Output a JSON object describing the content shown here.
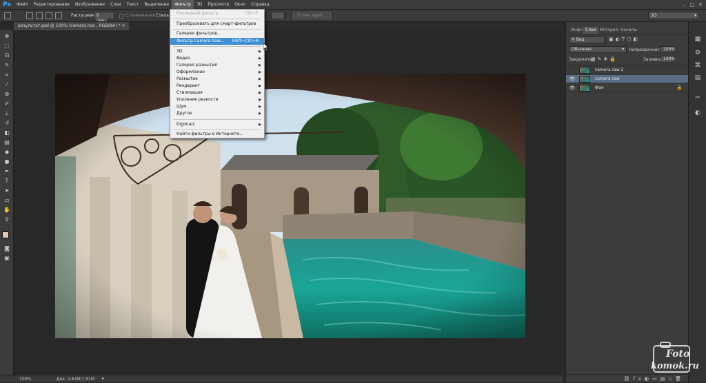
{
  "app": {
    "logo": "Ps"
  },
  "menubar": [
    "Файл",
    "Редактирование",
    "Изображение",
    "Слои",
    "Текст",
    "Выделение",
    "Фильтр",
    "3D",
    "Просмотр",
    "Окно",
    "Справка"
  ],
  "options": {
    "feather_label": "Растушевка:",
    "feather_value": "0 пикс.",
    "antialias_label": "Сглаживание",
    "style_label": "Стиль:",
    "refine_label": "Уточн. край...",
    "workspace": "3D"
  },
  "document": {
    "tab_title": "результат.psd @ 100% (camera raw , RGB/8#) *"
  },
  "filter_menu": {
    "last_filter": {
      "label": "Последний фильтр",
      "shortcut": "Ctrl+F"
    },
    "smart": "Преобразовать для смарт-фильтров",
    "gallery": "Галерея фильтров...",
    "camera_raw": {
      "label": "Фильтр Camera Raw...",
      "shortcut": "Shift+Ctrl+A"
    },
    "submenus": [
      "3D",
      "Видео",
      "Галерея размытия",
      "Оформление",
      "Размытие",
      "Рендеринг",
      "Стилизация",
      "Усиление резкости",
      "Шум",
      "Другое"
    ],
    "digimarc": "Digimarc",
    "online": "Найти фильтры в Интернете..."
  },
  "panel": {
    "tabs": [
      "Инфо",
      "Слои",
      "История",
      "Каналы"
    ],
    "kind": "Вид",
    "blend": "Обычные",
    "opacity_label": "Непрозрачность:",
    "opacity": "100%",
    "lock_label": "Закрепить:",
    "fill_label": "Заливка:",
    "fill": "100%",
    "layers": [
      {
        "name": "camera raw 2",
        "visible": false
      },
      {
        "name": "camera raw",
        "visible": true
      },
      {
        "name": "Фон",
        "visible": true
      }
    ]
  },
  "status": {
    "zoom": "100%",
    "doc": "Док: 2,64M/7,91M"
  },
  "watermark": {
    "line1": "Foto",
    "line2": "komok.ru"
  },
  "colors": {
    "accent": "#3e8fd6",
    "layer_selected": "#5b6c86"
  }
}
